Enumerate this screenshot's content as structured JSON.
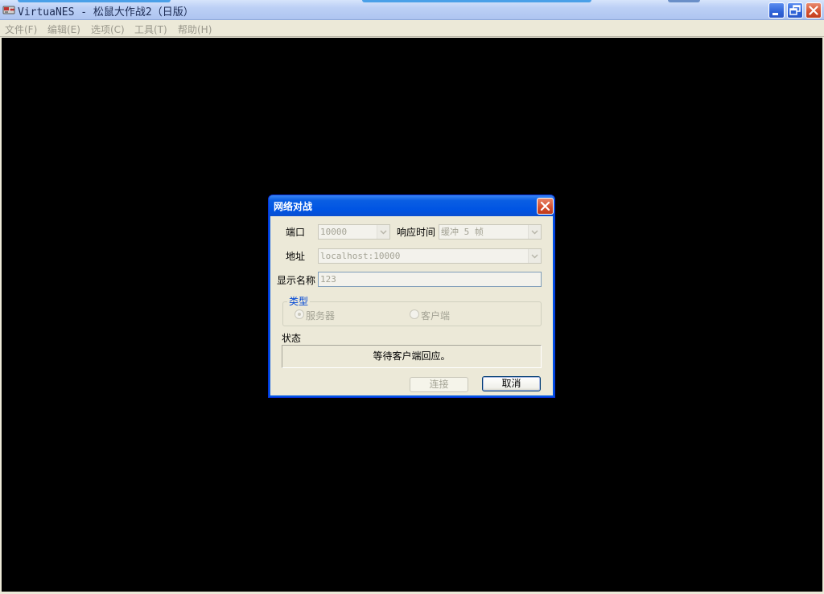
{
  "window": {
    "title": "VirtuaNES - 松鼠大作战2（日版）",
    "buttons": {
      "minimize": "minimize",
      "restore": "restore",
      "close": "close"
    }
  },
  "menubar": {
    "items": [
      {
        "label": "文件(F)"
      },
      {
        "label": "编辑(E)"
      },
      {
        "label": "选项(C)"
      },
      {
        "label": "工具(T)"
      },
      {
        "label": "帮助(H)"
      }
    ]
  },
  "dialog": {
    "title": "网络对战",
    "port_label": "端口",
    "port_value": "10000",
    "latency_label": "响应时间",
    "latency_value": "缓冲 5 帧",
    "address_label": "地址",
    "address_value": "localhost:10000",
    "display_name_label": "显示名称",
    "display_name_value": "123",
    "type_group_label": "类型",
    "type_options": [
      {
        "label": "服务器",
        "selected": true
      },
      {
        "label": "客户端",
        "selected": false
      }
    ],
    "status_label": "状态",
    "status_text": "等待客户端回应。",
    "connect_button": "连接",
    "cancel_button": "取消"
  },
  "colors": {
    "xp_blue": "#0054e3",
    "dialog_bg": "#ece9d8",
    "disabled_text": "#a4a395",
    "viewport": "#000000"
  }
}
